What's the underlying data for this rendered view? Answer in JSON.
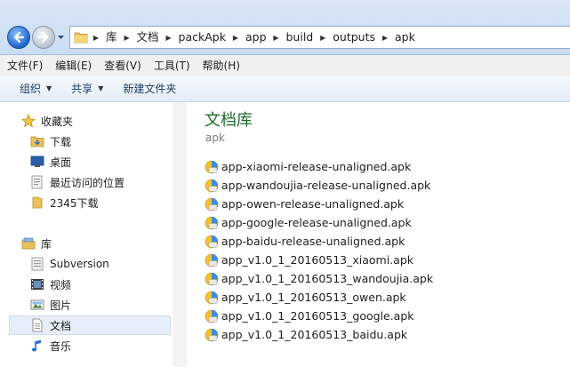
{
  "address": {
    "crumbs": [
      "库",
      "文档",
      "packApk",
      "app",
      "build",
      "outputs",
      "apk"
    ]
  },
  "menu": [
    "文件(F)",
    "编辑(E)",
    "查看(V)",
    "工具(T)",
    "帮助(H)"
  ],
  "commands": {
    "organize": "组织",
    "share": "共享",
    "new_folder": "新建文件夹"
  },
  "nav": {
    "favorites_header": "收藏夹",
    "favorites": [
      "下载",
      "桌面",
      "最近访问的位置",
      "2345下载"
    ],
    "libraries_header": "库",
    "libraries": [
      "Subversion",
      "视频",
      "图片",
      "文档",
      "音乐"
    ],
    "selected": "文档"
  },
  "content": {
    "library_title": "文档库",
    "library_subtitle": "apk",
    "files": [
      "app-xiaomi-release-unaligned.apk",
      "app-wandoujia-release-unaligned.apk",
      "app-owen-release-unaligned.apk",
      "app-google-release-unaligned.apk",
      "app-baidu-release-unaligned.apk",
      "app_v1.0_1_20160513_xiaomi.apk",
      "app_v1.0_1_20160513_wandoujia.apk",
      "app_v1.0_1_20160513_owen.apk",
      "app_v1.0_1_20160513_google.apk",
      "app_v1.0_1_20160513_baidu.apk"
    ]
  },
  "colors": {
    "library_title": "#1e6b2c",
    "selection": "#e5eef9",
    "back_button": "#1f63c9"
  }
}
